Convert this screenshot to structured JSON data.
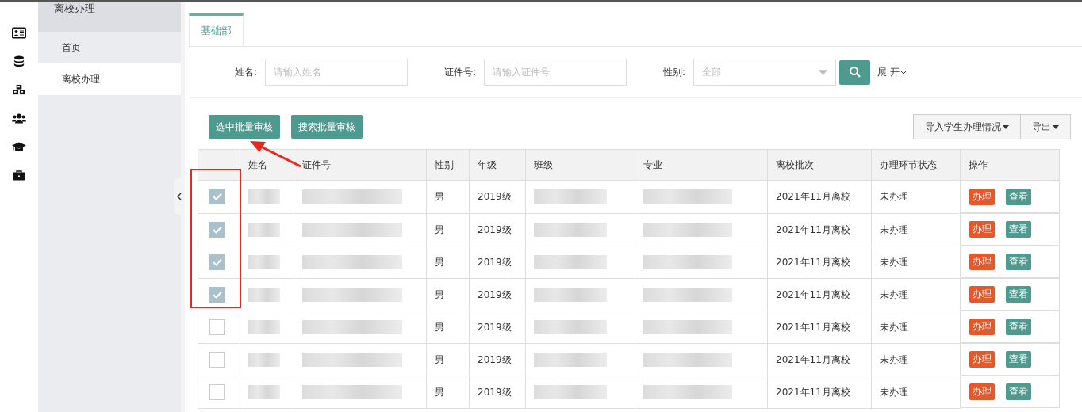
{
  "sidebar": {
    "header": "离校办理",
    "items": [
      {
        "label": "首页",
        "selected": false
      },
      {
        "label": "离校办理",
        "selected": true
      }
    ]
  },
  "tabs": [
    {
      "label": "基础部",
      "selected": true
    }
  ],
  "filters": [
    {
      "label": "姓名:",
      "kind": "text",
      "placeholder": "请输入姓名"
    },
    {
      "label": "证件号:",
      "kind": "text",
      "placeholder": "请输入证件号"
    },
    {
      "label": "性别:",
      "kind": "select",
      "placeholder": "全部"
    }
  ],
  "expand_toggle": "展 开",
  "batch_buttons": [
    "选中批量审核",
    "搜索批量审核"
  ],
  "dropdown_buttons": [
    "导入学生办理情况",
    "导出"
  ],
  "table": {
    "columns": [
      "",
      "姓名",
      "证件号",
      "性别",
      "年级",
      "班级",
      "专业",
      "离校批次",
      "办理环节状态",
      "操作"
    ],
    "rows": [
      {
        "checked": true,
        "gender": "男",
        "grade": "2019级",
        "batch": "2021年11月离校",
        "status": "未办理",
        "actions": [
          {
            "label": "办理",
            "kind": "process"
          },
          {
            "label": "查看",
            "kind": "view"
          }
        ]
      },
      {
        "checked": true,
        "gender": "男",
        "grade": "2019级",
        "batch": "2021年11月离校",
        "status": "未办理",
        "actions": [
          {
            "label": "办理",
            "kind": "process"
          },
          {
            "label": "查看",
            "kind": "view"
          }
        ]
      },
      {
        "checked": true,
        "gender": "男",
        "grade": "2019级",
        "batch": "2021年11月离校",
        "status": "未办理",
        "actions": [
          {
            "label": "办理",
            "kind": "process"
          },
          {
            "label": "查看",
            "kind": "view"
          }
        ]
      },
      {
        "checked": true,
        "gender": "男",
        "grade": "2019级",
        "batch": "2021年11月离校",
        "status": "未办理",
        "actions": [
          {
            "label": "办理",
            "kind": "process"
          },
          {
            "label": "查看",
            "kind": "view"
          }
        ]
      },
      {
        "checked": false,
        "gender": "男",
        "grade": "2019级",
        "batch": "2021年11月离校",
        "status": "未办理",
        "actions": [
          {
            "label": "办理",
            "kind": "process"
          },
          {
            "label": "查看",
            "kind": "view"
          }
        ]
      },
      {
        "checked": false,
        "gender": "男",
        "grade": "2019级",
        "batch": "2021年11月离校",
        "status": "未办理",
        "actions": [
          {
            "label": "办理",
            "kind": "process"
          },
          {
            "label": "查看",
            "kind": "view"
          }
        ]
      },
      {
        "checked": false,
        "gender": "男",
        "grade": "2019级",
        "batch": "2021年11月离校",
        "status": "未办理",
        "actions": [
          {
            "label": "办理",
            "kind": "process"
          },
          {
            "label": "查看",
            "kind": "view"
          }
        ]
      }
    ]
  }
}
